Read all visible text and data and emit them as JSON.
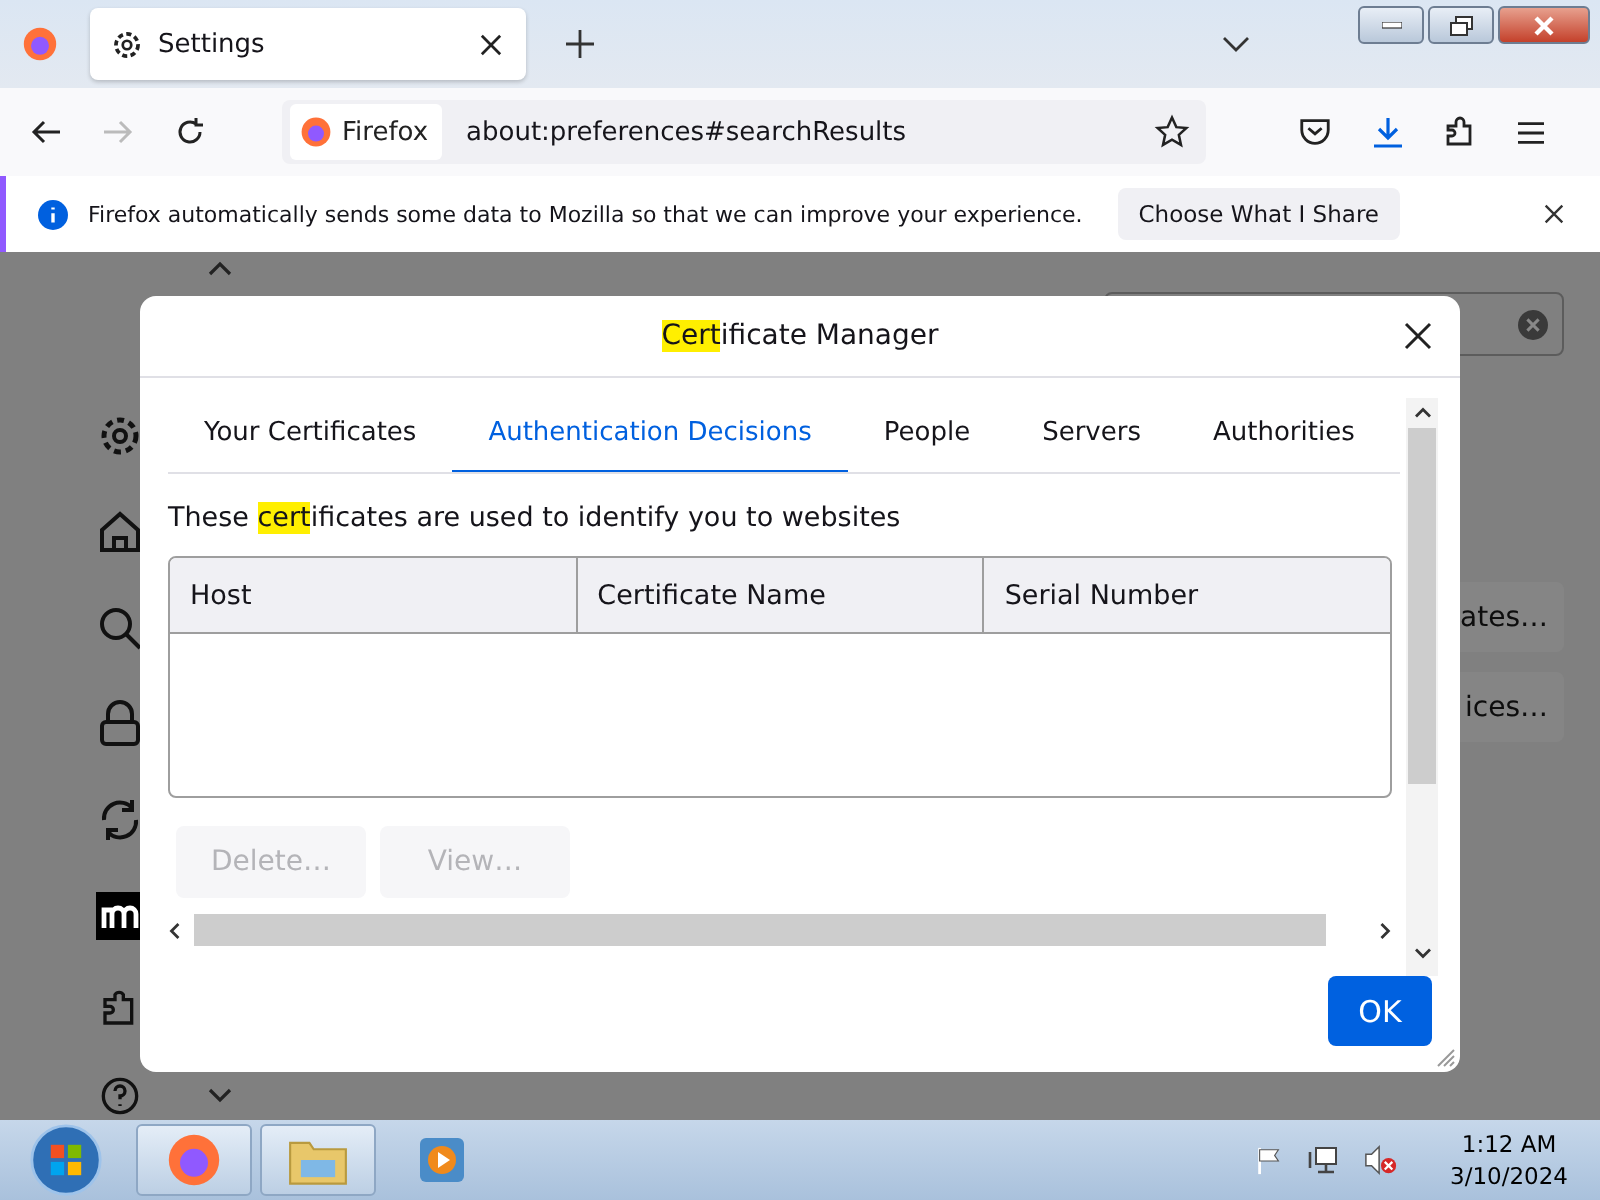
{
  "browser": {
    "tab": {
      "title": "Settings"
    },
    "identity": "Firefox",
    "url": "about:preferences#searchResults"
  },
  "notification": {
    "message": "Firefox automatically sends some data to Mozilla so that we can improve your experience.",
    "button": "Choose What I Share"
  },
  "background": {
    "buttons": [
      "ates…",
      "ices…"
    ]
  },
  "dialog": {
    "title": [
      {
        "text": "Cert",
        "highlighted": true
      },
      {
        "text": "ificate Manager",
        "highlighted": false
      }
    ],
    "tabs": [
      {
        "label": "Your Certificates",
        "selected": false
      },
      {
        "label": "Authentication Decisions",
        "selected": true
      },
      {
        "label": "People",
        "selected": false
      },
      {
        "label": "Servers",
        "selected": false
      },
      {
        "label": "Authorities",
        "selected": false
      }
    ],
    "description": [
      {
        "text": "These ",
        "highlighted": false
      },
      {
        "text": "cert",
        "highlighted": true
      },
      {
        "text": "ificates are used to identify you to websites",
        "highlighted": false
      }
    ],
    "columns": [
      "Host",
      "Certificate Name",
      "Serial Number"
    ],
    "actions": [
      {
        "label": "Delete…",
        "disabled": true
      },
      {
        "label": "View…",
        "disabled": true
      }
    ],
    "ok": "OK"
  },
  "taskbar": {
    "time": "1:12 AM",
    "date": "3/10/2024"
  }
}
